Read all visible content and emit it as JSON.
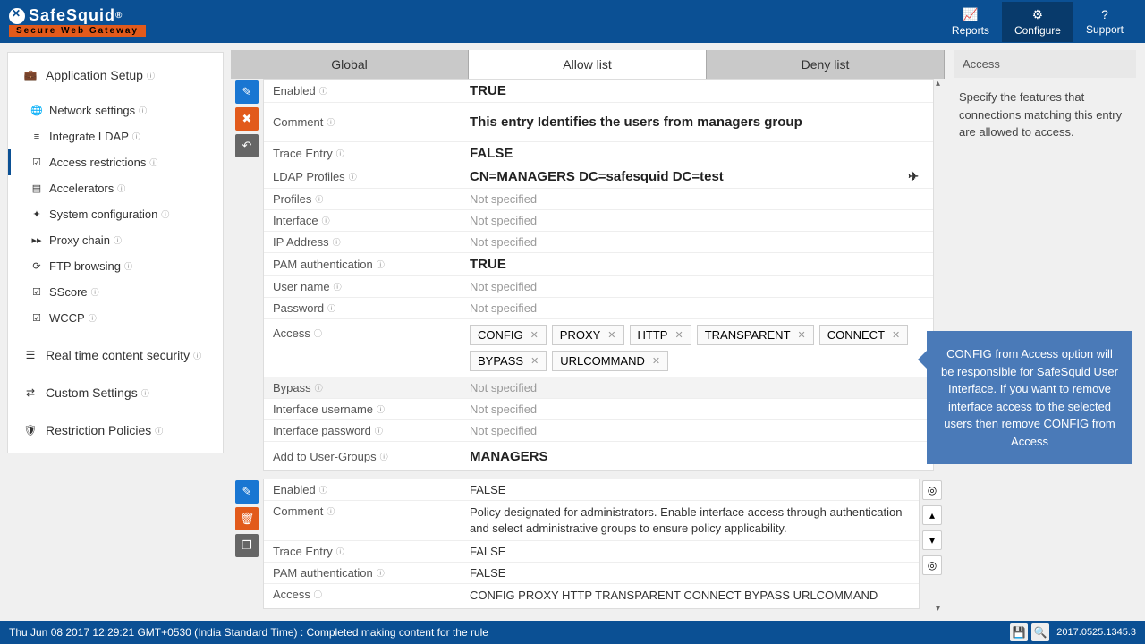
{
  "header": {
    "logo_text": "SafeSquid",
    "logo_reg": "®",
    "logo_sub": "Secure Web Gateway",
    "nav": {
      "reports": "Reports",
      "configure": "Configure",
      "support": "Support"
    }
  },
  "sidebar": {
    "app_setup": "Application Setup",
    "items": [
      {
        "icon": "🌐",
        "label": "Network settings"
      },
      {
        "icon": "≡",
        "label": "Integrate LDAP"
      },
      {
        "icon": "✔",
        "label": "Access restrictions",
        "active": true
      },
      {
        "icon": "▤",
        "label": "Accelerators"
      },
      {
        "icon": "✦",
        "label": "System configuration"
      },
      {
        "icon": "▸▸",
        "label": "Proxy chain"
      },
      {
        "icon": "⟳",
        "label": "FTP browsing"
      },
      {
        "icon": "✔",
        "label": "SScore"
      },
      {
        "icon": "✔",
        "label": "WCCP"
      }
    ],
    "realtime": "Real time content security",
    "custom": "Custom Settings",
    "restriction": "Restriction Policies"
  },
  "tabs": {
    "global": "Global",
    "allow": "Allow list",
    "deny": "Deny list"
  },
  "entry1": {
    "enabled_label": "Enabled",
    "enabled_value": "TRUE",
    "comment_label": "Comment",
    "comment_value": "This entry Identifies the users from managers group",
    "trace_label": "Trace Entry",
    "trace_value": "FALSE",
    "ldap_label": "LDAP Profiles",
    "ldap_value": "CN=MANAGERS DC=safesquid DC=test",
    "profiles_label": "Profiles",
    "profiles_value": "Not specified",
    "interface_label": "Interface",
    "interface_value": "Not specified",
    "ip_label": "IP Address",
    "ip_value": "Not specified",
    "pam_label": "PAM authentication",
    "pam_value": "TRUE",
    "user_label": "User name",
    "user_value": "Not specified",
    "pass_label": "Password",
    "pass_value": "Not specified",
    "access_label": "Access",
    "access_tags": [
      "CONFIG",
      "PROXY",
      "HTTP",
      "TRANSPARENT",
      "CONNECT",
      "BYPASS",
      "URLCOMMAND"
    ],
    "bypass_label": "Bypass",
    "bypass_value": "Not specified",
    "ifuser_label": "Interface username",
    "ifuser_value": "Not specified",
    "ifpass_label": "Interface password",
    "ifpass_value": "Not specified",
    "addgroup_label": "Add to User-Groups",
    "addgroup_value": "MANAGERS"
  },
  "entry2": {
    "enabled_label": "Enabled",
    "enabled_value": "FALSE",
    "comment_label": "Comment",
    "comment_value": "Policy designated for administrators. Enable interface access through authentication and select administrative groups to ensure policy applicability.",
    "trace_label": "Trace Entry",
    "trace_value": "FALSE",
    "pam_label": "PAM authentication",
    "pam_value": "FALSE",
    "access_label": "Access",
    "access_value": "CONFIG   PROXY   HTTP   TRANSPARENT   CONNECT   BYPASS   URLCOMMAND"
  },
  "right_panel": {
    "title": "Access",
    "text": "Specify the features that connections matching this entry are allowed to access."
  },
  "callout_text": "CONFIG from Access option will be responsible for SafeSquid User Interface. If you want to remove interface access to the selected users then remove CONFIG from Access",
  "footer": {
    "status": "Thu Jun 08 2017 12:29:21 GMT+0530 (India Standard Time) : Completed making content for the rule",
    "version": "2017.0525.1345.3"
  }
}
